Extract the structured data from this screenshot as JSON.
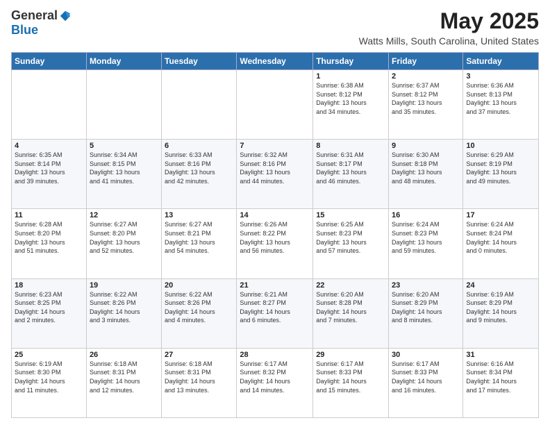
{
  "header": {
    "logo_general": "General",
    "logo_blue": "Blue",
    "month": "May 2025",
    "location": "Watts Mills, South Carolina, United States"
  },
  "days_of_week": [
    "Sunday",
    "Monday",
    "Tuesday",
    "Wednesday",
    "Thursday",
    "Friday",
    "Saturday"
  ],
  "weeks": [
    [
      {
        "day": "",
        "info": ""
      },
      {
        "day": "",
        "info": ""
      },
      {
        "day": "",
        "info": ""
      },
      {
        "day": "",
        "info": ""
      },
      {
        "day": "1",
        "info": "Sunrise: 6:38 AM\nSunset: 8:12 PM\nDaylight: 13 hours\nand 34 minutes."
      },
      {
        "day": "2",
        "info": "Sunrise: 6:37 AM\nSunset: 8:12 PM\nDaylight: 13 hours\nand 35 minutes."
      },
      {
        "day": "3",
        "info": "Sunrise: 6:36 AM\nSunset: 8:13 PM\nDaylight: 13 hours\nand 37 minutes."
      }
    ],
    [
      {
        "day": "4",
        "info": "Sunrise: 6:35 AM\nSunset: 8:14 PM\nDaylight: 13 hours\nand 39 minutes."
      },
      {
        "day": "5",
        "info": "Sunrise: 6:34 AM\nSunset: 8:15 PM\nDaylight: 13 hours\nand 41 minutes."
      },
      {
        "day": "6",
        "info": "Sunrise: 6:33 AM\nSunset: 8:16 PM\nDaylight: 13 hours\nand 42 minutes."
      },
      {
        "day": "7",
        "info": "Sunrise: 6:32 AM\nSunset: 8:16 PM\nDaylight: 13 hours\nand 44 minutes."
      },
      {
        "day": "8",
        "info": "Sunrise: 6:31 AM\nSunset: 8:17 PM\nDaylight: 13 hours\nand 46 minutes."
      },
      {
        "day": "9",
        "info": "Sunrise: 6:30 AM\nSunset: 8:18 PM\nDaylight: 13 hours\nand 48 minutes."
      },
      {
        "day": "10",
        "info": "Sunrise: 6:29 AM\nSunset: 8:19 PM\nDaylight: 13 hours\nand 49 minutes."
      }
    ],
    [
      {
        "day": "11",
        "info": "Sunrise: 6:28 AM\nSunset: 8:20 PM\nDaylight: 13 hours\nand 51 minutes."
      },
      {
        "day": "12",
        "info": "Sunrise: 6:27 AM\nSunset: 8:20 PM\nDaylight: 13 hours\nand 52 minutes."
      },
      {
        "day": "13",
        "info": "Sunrise: 6:27 AM\nSunset: 8:21 PM\nDaylight: 13 hours\nand 54 minutes."
      },
      {
        "day": "14",
        "info": "Sunrise: 6:26 AM\nSunset: 8:22 PM\nDaylight: 13 hours\nand 56 minutes."
      },
      {
        "day": "15",
        "info": "Sunrise: 6:25 AM\nSunset: 8:23 PM\nDaylight: 13 hours\nand 57 minutes."
      },
      {
        "day": "16",
        "info": "Sunrise: 6:24 AM\nSunset: 8:23 PM\nDaylight: 13 hours\nand 59 minutes."
      },
      {
        "day": "17",
        "info": "Sunrise: 6:24 AM\nSunset: 8:24 PM\nDaylight: 14 hours\nand 0 minutes."
      }
    ],
    [
      {
        "day": "18",
        "info": "Sunrise: 6:23 AM\nSunset: 8:25 PM\nDaylight: 14 hours\nand 2 minutes."
      },
      {
        "day": "19",
        "info": "Sunrise: 6:22 AM\nSunset: 8:26 PM\nDaylight: 14 hours\nand 3 minutes."
      },
      {
        "day": "20",
        "info": "Sunrise: 6:22 AM\nSunset: 8:26 PM\nDaylight: 14 hours\nand 4 minutes."
      },
      {
        "day": "21",
        "info": "Sunrise: 6:21 AM\nSunset: 8:27 PM\nDaylight: 14 hours\nand 6 minutes."
      },
      {
        "day": "22",
        "info": "Sunrise: 6:20 AM\nSunset: 8:28 PM\nDaylight: 14 hours\nand 7 minutes."
      },
      {
        "day": "23",
        "info": "Sunrise: 6:20 AM\nSunset: 8:29 PM\nDaylight: 14 hours\nand 8 minutes."
      },
      {
        "day": "24",
        "info": "Sunrise: 6:19 AM\nSunset: 8:29 PM\nDaylight: 14 hours\nand 9 minutes."
      }
    ],
    [
      {
        "day": "25",
        "info": "Sunrise: 6:19 AM\nSunset: 8:30 PM\nDaylight: 14 hours\nand 11 minutes."
      },
      {
        "day": "26",
        "info": "Sunrise: 6:18 AM\nSunset: 8:31 PM\nDaylight: 14 hours\nand 12 minutes."
      },
      {
        "day": "27",
        "info": "Sunrise: 6:18 AM\nSunset: 8:31 PM\nDaylight: 14 hours\nand 13 minutes."
      },
      {
        "day": "28",
        "info": "Sunrise: 6:17 AM\nSunset: 8:32 PM\nDaylight: 14 hours\nand 14 minutes."
      },
      {
        "day": "29",
        "info": "Sunrise: 6:17 AM\nSunset: 8:33 PM\nDaylight: 14 hours\nand 15 minutes."
      },
      {
        "day": "30",
        "info": "Sunrise: 6:17 AM\nSunset: 8:33 PM\nDaylight: 14 hours\nand 16 minutes."
      },
      {
        "day": "31",
        "info": "Sunrise: 6:16 AM\nSunset: 8:34 PM\nDaylight: 14 hours\nand 17 minutes."
      }
    ]
  ]
}
